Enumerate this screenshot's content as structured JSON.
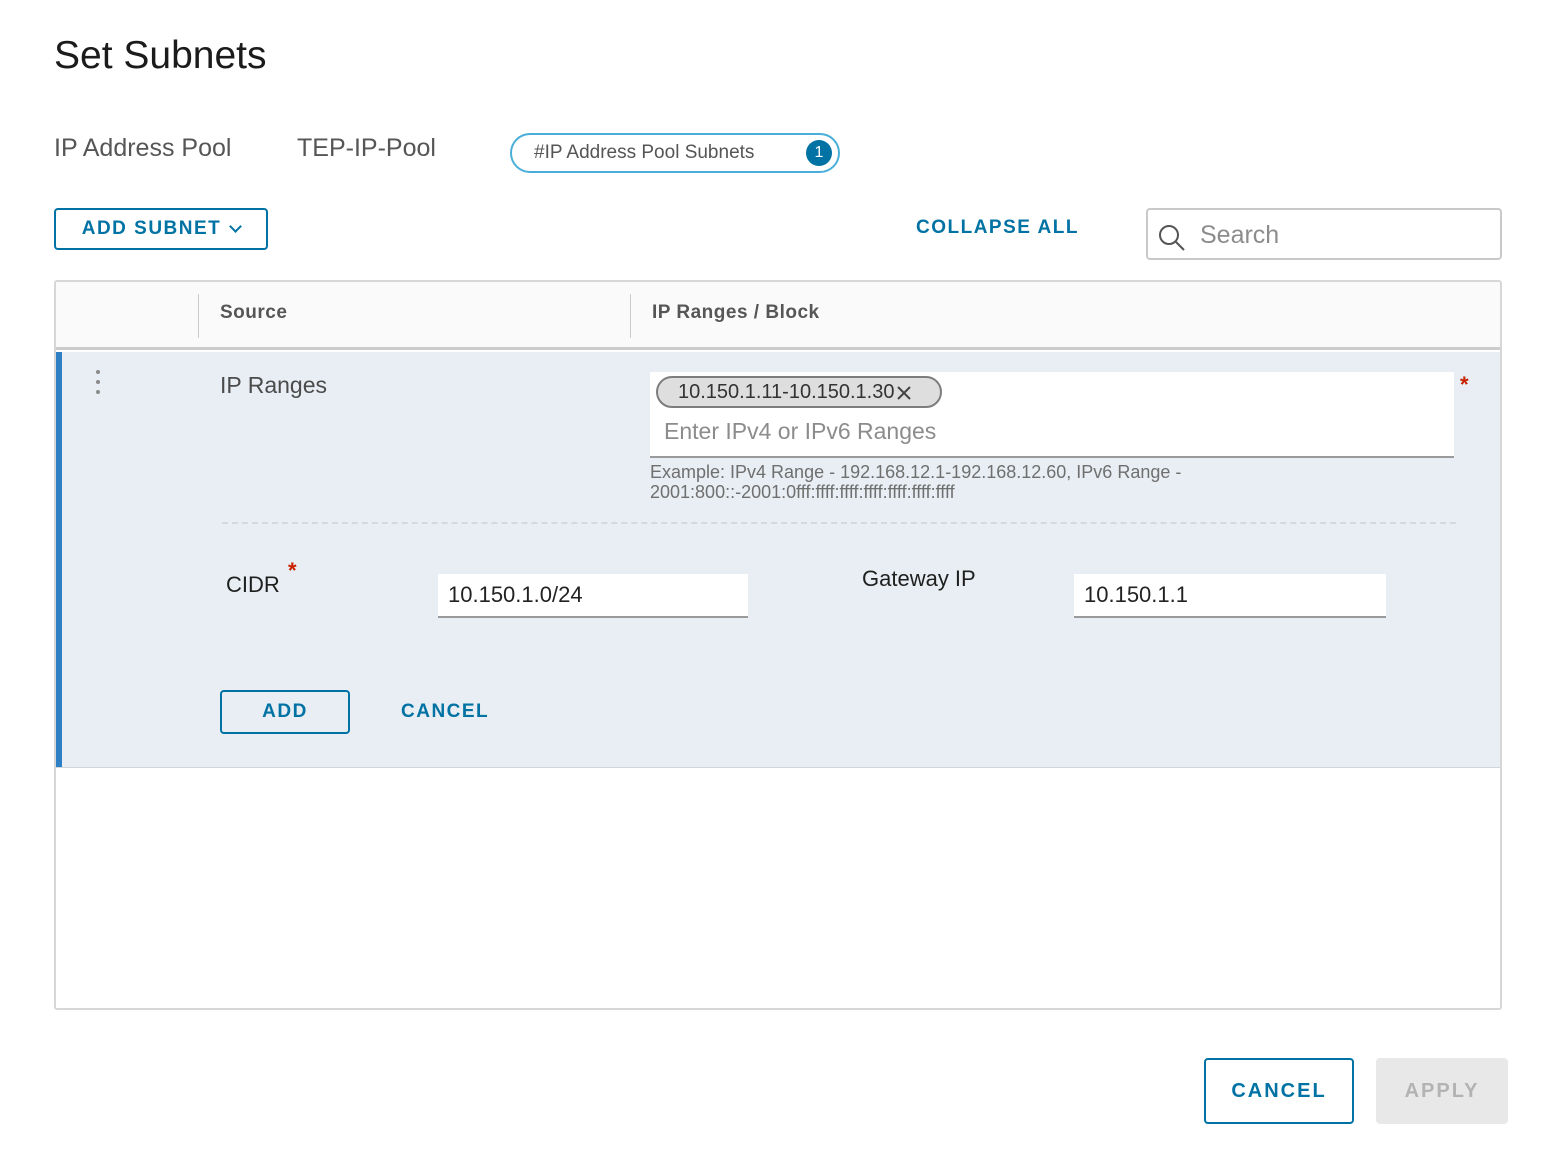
{
  "dialog": {
    "title": "Set Subnets"
  },
  "pool": {
    "label": "IP Address Pool",
    "name": "TEP-IP-Pool",
    "subnets_pill_label": "#IP Address Pool Subnets",
    "subnets_count": "1"
  },
  "toolbar": {
    "add_subnet_label": "ADD SUBNET",
    "collapse_all_label": "COLLAPSE ALL",
    "search_placeholder": "Search"
  },
  "grid": {
    "columns": [
      "Source",
      "IP Ranges / Block"
    ],
    "row": {
      "source": "IP Ranges",
      "ranges_chip": "10.150.1.11-10.150.1.30",
      "ranges_placeholder": "Enter IPv4 or IPv6 Ranges",
      "required_marker": "*",
      "helper_text": "Example: IPv4 Range - 192.168.12.1-192.168.12.60, IPv6 Range - 2001:800::-2001:0fff:ffff:ffff:ffff:ffff:ffff:ffff",
      "cidr_label": "CIDR",
      "cidr_value": "10.150.1.0/24",
      "gateway_label": "Gateway IP",
      "gateway_value": "10.150.1.1",
      "add_label": "ADD",
      "cancel_label": "CANCEL"
    }
  },
  "footer": {
    "cancel_label": "CANCEL",
    "apply_label": "APPLY"
  },
  "colors": {
    "accent": "#0072a3",
    "row_highlight": "#e8eef3",
    "row_bar": "#2f7fc4",
    "required": "#c92100",
    "pill_border": "#49afd9"
  },
  "icons": {
    "search": "search-icon",
    "kebab": "kebab-menu-icon",
    "chip_remove": "close-icon",
    "dropdown": "chevron-down-icon"
  }
}
